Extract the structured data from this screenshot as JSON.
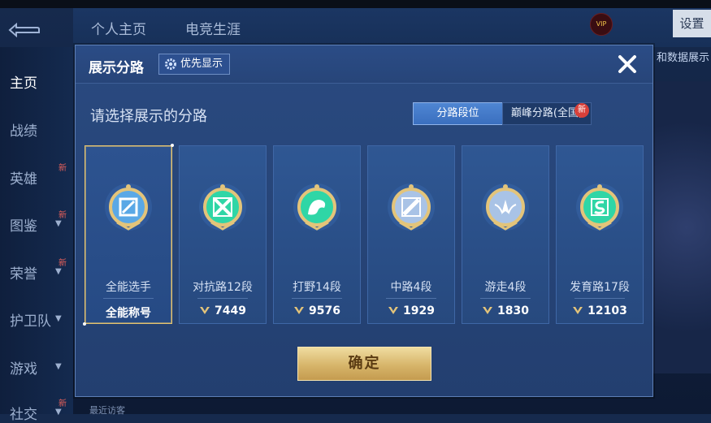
{
  "background": {
    "tabs": [
      "个人主页",
      "电竞生涯"
    ],
    "sidebar": [
      {
        "label": "主页",
        "active": true,
        "new": false,
        "chevron": false
      },
      {
        "label": "战绩",
        "active": false,
        "new": false,
        "chevron": false
      },
      {
        "label": "英雄",
        "active": false,
        "new": true,
        "chevron": false
      },
      {
        "label": "图鉴",
        "active": false,
        "new": true,
        "chevron": true
      },
      {
        "label": "荣誉",
        "active": false,
        "new": true,
        "chevron": true
      },
      {
        "label": "护卫队",
        "active": false,
        "new": false,
        "chevron": true
      },
      {
        "label": "游戏",
        "active": false,
        "new": false,
        "chevron": true
      },
      {
        "label": "社交",
        "active": false,
        "new": true,
        "chevron": true
      }
    ],
    "new_label": "新",
    "settings_label": "设置",
    "vip_label": "VIP",
    "right_text": "和数据展示",
    "bottom_text": "最近访客"
  },
  "dialog": {
    "title": "展示分路",
    "priority_label": "优先显示",
    "prompt": "请选择展示的分路",
    "segments": [
      "分路段位",
      "巅峰分路(全国)"
    ],
    "segment_new": "新",
    "confirm_label": "确定",
    "cards": [
      {
        "label": "全能选手",
        "value": "全能称号",
        "selected": true,
        "color": "#5aa8e6",
        "show_points": false
      },
      {
        "label": "对抗路12段",
        "value": "7449",
        "selected": false,
        "color": "#2fd6a6",
        "show_points": true
      },
      {
        "label": "打野14段",
        "value": "9576",
        "selected": false,
        "color": "#2fd6a6",
        "show_points": true
      },
      {
        "label": "中路4段",
        "value": "1929",
        "selected": false,
        "color": "#a9c3e6",
        "show_points": true
      },
      {
        "label": "游走4段",
        "value": "1830",
        "selected": false,
        "color": "#a9c3e6",
        "show_points": true
      },
      {
        "label": "发育路17段",
        "value": "12103",
        "selected": false,
        "color": "#2fd6a6",
        "show_points": true
      }
    ]
  },
  "colors": {
    "gold": "#e6c46f",
    "accent": "#4f86d3",
    "new_badge": "#d8403a"
  }
}
